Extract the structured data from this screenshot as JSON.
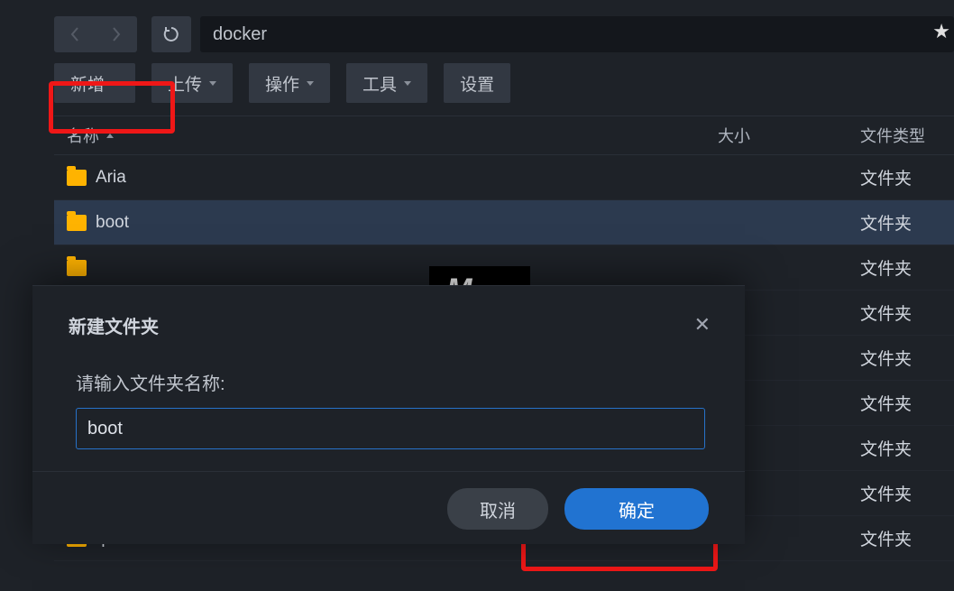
{
  "path_value": "docker",
  "toolbar": {
    "new_label": "新增",
    "upload_label": "上传",
    "operate_label": "操作",
    "tool_label": "工具",
    "settings_label": "设置"
  },
  "columns": {
    "name": "名称",
    "size": "大小",
    "type": "文件类型"
  },
  "type_folder": "文件夹",
  "rows": [
    {
      "name": "Aria"
    },
    {
      "name": "boot"
    },
    {
      "name": ""
    },
    {
      "name": ""
    },
    {
      "name": ""
    },
    {
      "name": ""
    },
    {
      "name": ""
    },
    {
      "name": ""
    },
    {
      "name": "qiandao"
    }
  ],
  "modal": {
    "title": "新建文件夹",
    "label": "请输入文件夹名称:",
    "value": "boot",
    "cancel": "取消",
    "confirm": "确定"
  },
  "watermark": "Mspace.cc"
}
